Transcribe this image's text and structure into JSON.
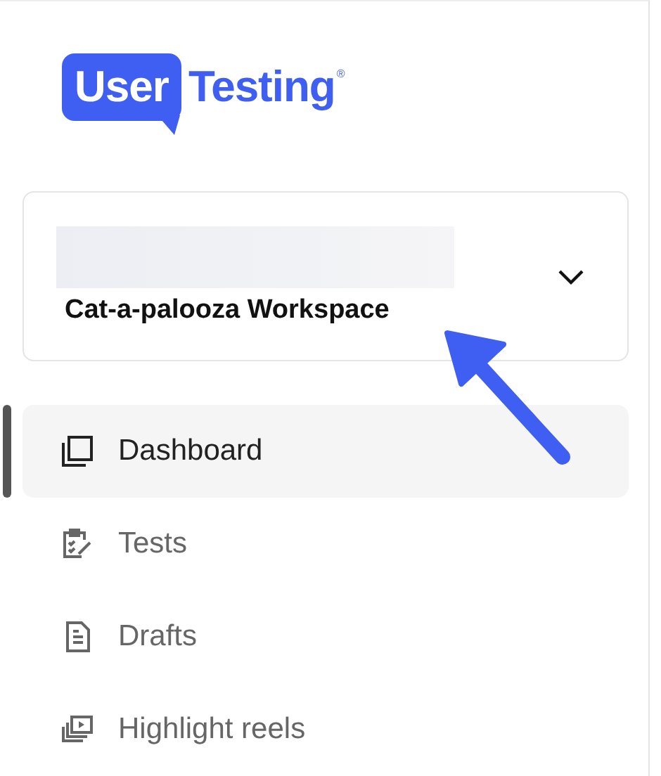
{
  "logo": {
    "badge": "User",
    "word": "Testing",
    "mark": "®"
  },
  "workspace": {
    "name": "Cat-a-palooza Workspace"
  },
  "nav": [
    {
      "label": "Dashboard",
      "selected": true
    },
    {
      "label": "Tests",
      "selected": false
    },
    {
      "label": "Drafts",
      "selected": false
    },
    {
      "label": "Highlight reels",
      "selected": false
    }
  ]
}
